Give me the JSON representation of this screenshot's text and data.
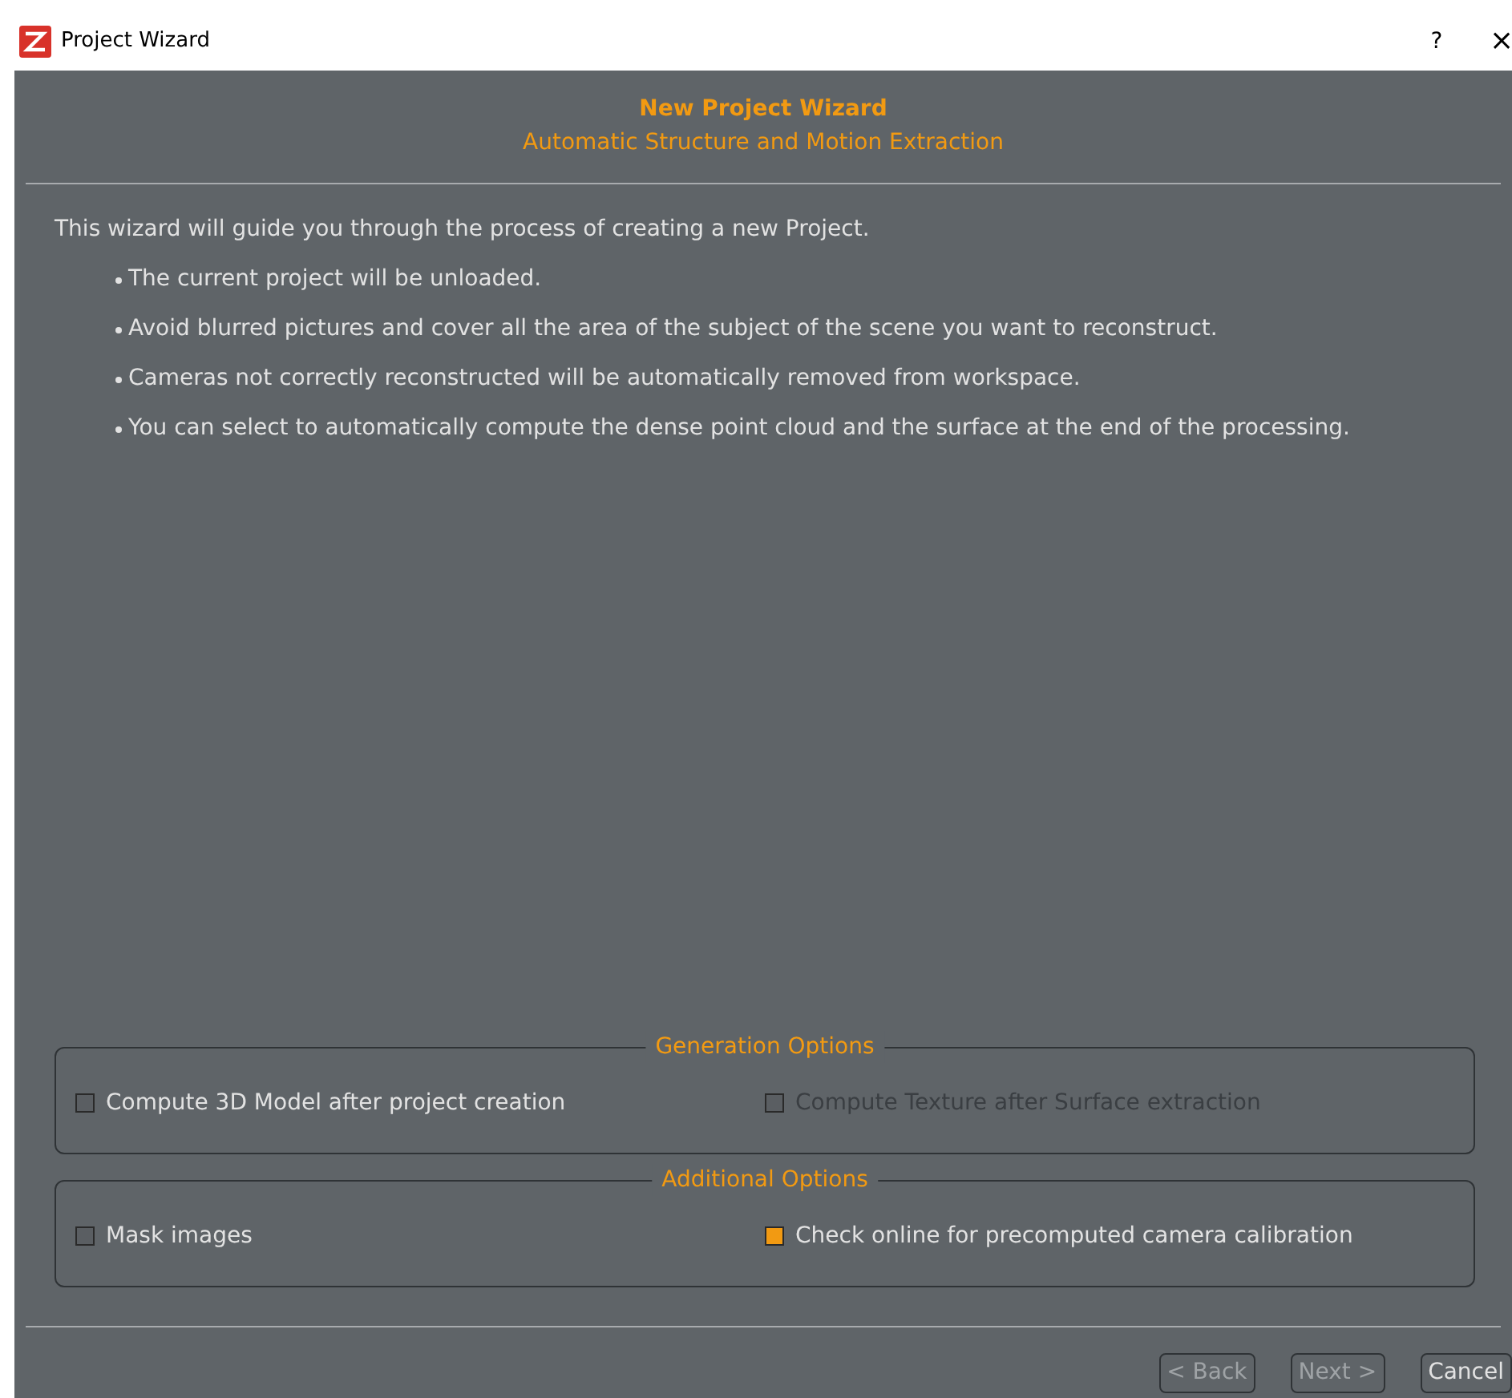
{
  "window": {
    "title": "Project Wizard",
    "help": "?",
    "close": "×"
  },
  "header": {
    "title": "New Project Wizard",
    "subtitle": "Automatic Structure and Motion Extraction"
  },
  "intro": "This wizard will guide you through the process of creating a new Project.",
  "bullets": [
    {
      "text": "The current project will be unloaded."
    },
    {
      "text": "Avoid blurred pictures and cover all the area of the subject of the scene you want to reconstruct."
    },
    {
      "text": "Cameras not correctly reconstructed will be automatically removed from workspace."
    },
    {
      "text": "You can select to automatically compute the dense point cloud and the surface at the end of the processing."
    }
  ],
  "groups": [
    {
      "title": "Generation Options",
      "options": [
        {
          "label": "Compute 3D Model after project creation",
          "checked": false,
          "disabled": false
        },
        {
          "label": "Compute Texture after Surface extraction",
          "checked": false,
          "disabled": true
        }
      ]
    },
    {
      "title": "Additional Options",
      "options": [
        {
          "label": "Mask images",
          "checked": false,
          "disabled": false
        },
        {
          "label": "Check online for precomputed camera calibration",
          "checked": true,
          "disabled": false
        }
      ]
    }
  ],
  "buttons": [
    {
      "label": "< Back",
      "disabled": true
    },
    {
      "label": "Next >",
      "disabled": true
    },
    {
      "label": "Cancel",
      "disabled": false
    }
  ]
}
